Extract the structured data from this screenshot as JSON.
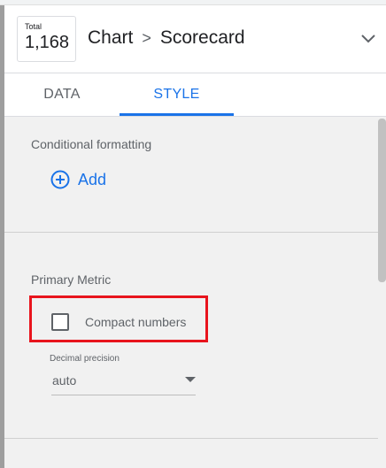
{
  "header": {
    "chart_icon": {
      "label": "Total",
      "value": "1,168"
    },
    "breadcrumb": {
      "parent": "Chart",
      "separator": ">",
      "current": "Scorecard"
    },
    "collapse_icon": "chevron-down-icon"
  },
  "tabs": [
    {
      "label": "DATA",
      "active": false
    },
    {
      "label": "STYLE",
      "active": true
    }
  ],
  "style_panel": {
    "conditional_formatting": {
      "title": "Conditional formatting",
      "add_label": "Add",
      "add_icon": "add-circle-icon"
    },
    "primary_metric": {
      "title": "Primary Metric",
      "compact_numbers": {
        "label": "Compact numbers",
        "checked": false
      },
      "decimal_precision": {
        "label": "Decimal precision",
        "value": "auto"
      }
    }
  },
  "colors": {
    "accent": "#1a73e8",
    "highlight": "#e8141d",
    "panel_bg": "#f1f1f1"
  }
}
